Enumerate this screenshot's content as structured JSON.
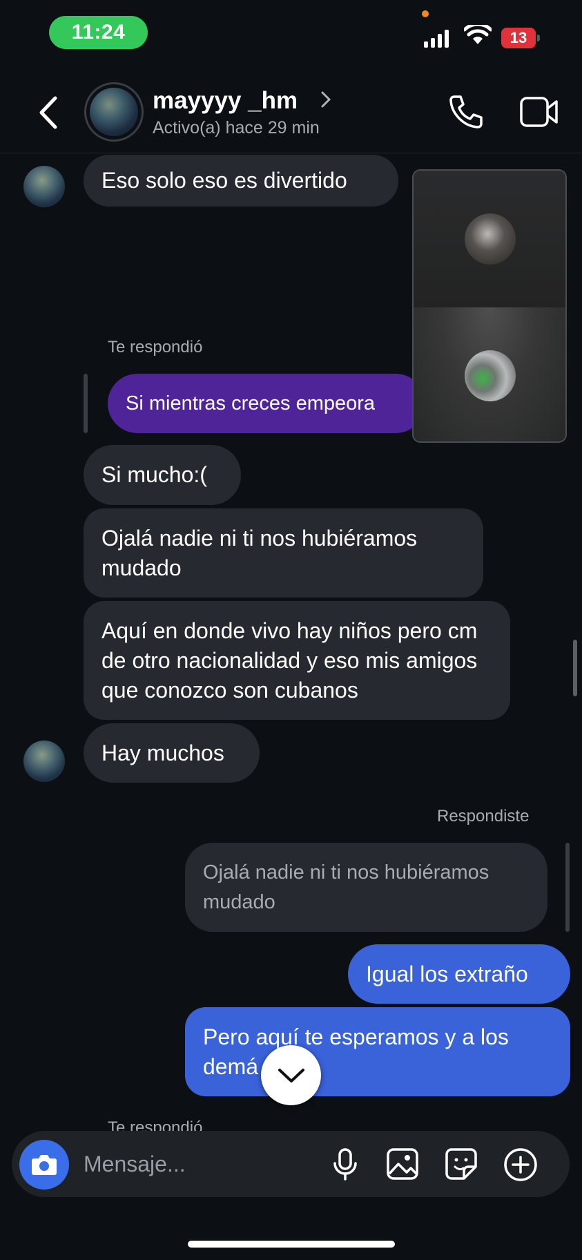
{
  "status_bar": {
    "time": "11:24",
    "battery": "13"
  },
  "header": {
    "username": "mayyyy _hm",
    "status": "Activo(a) hace 29 min"
  },
  "messages": {
    "m1": "Eso solo eso es divertido",
    "reply_label_1": "Te respondió",
    "m2_reply": "Si mientras creces empeora",
    "m3": "Si mucho:(",
    "m4": "Ojalá nadie ni ti nos hubiéramos mudado",
    "m5": "Aquí en donde vivo hay niños pero cm de otro nacionalidad y eso mis amigos que conozco son cubanos",
    "m6": "Hay muchos",
    "reply_label_2": "Respondiste",
    "quote_out": "Ojalá nadie ni ti nos hubiéramos mudado",
    "m7": "Igual los extraño",
    "m8": "Pero aquí te esperamos y a los demá",
    "reply_label_3": "Te respondió"
  },
  "composer": {
    "placeholder": "Mensaje..."
  },
  "colors": {
    "background": "#0c1014",
    "incoming_bubble": "#262a30",
    "outgoing_bubble": "#3a62d9",
    "reply_bubble": "#4f2499",
    "online_time_pill": "#34c759",
    "camera_button": "#3a6ee8"
  },
  "icons": [
    "signal-icon",
    "wifi-icon",
    "battery-icon",
    "back-icon",
    "chevron-right-icon",
    "phone-icon",
    "video-camera-icon",
    "chevron-down-icon",
    "camera-icon",
    "microphone-icon",
    "image-icon",
    "sticker-icon",
    "plus-icon"
  ]
}
